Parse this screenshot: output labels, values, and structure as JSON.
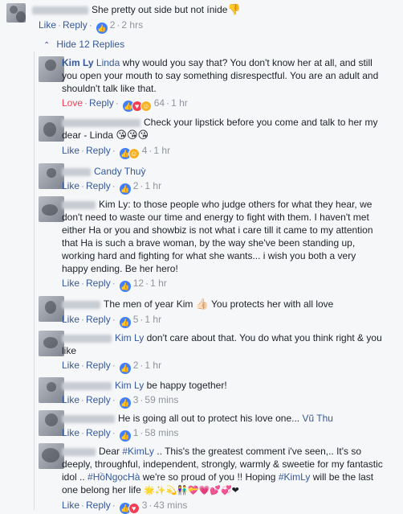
{
  "top_comment": {
    "text": "She pretty out side but not ínide",
    "emoji": "👎",
    "like": "Like",
    "reply": "Reply",
    "reactions": "2",
    "time": "2 hrs"
  },
  "hide_replies": "Hide 12 Replies",
  "replies": [
    {
      "name": "Kim Ly",
      "tag": "Linda",
      "text": "why would you say that? You don't know her at all, and still you open your mouth to say something disrespectful. You are an adult and shouldn't talk like that.",
      "action": "Love",
      "reply": "Reply",
      "reactions": "64",
      "time": "1 hr"
    },
    {
      "text": "Check your lipstick before you come and talk to her my dear - Linda",
      "emoji": "😘😘😘",
      "like": "Like",
      "reply": "Reply",
      "reactions": "4",
      "time": "1 hr"
    },
    {
      "name": "Candy Thuỳ",
      "like": "Like",
      "reply": "Reply",
      "reactions": "2",
      "time": "1 hr"
    },
    {
      "text": "Kim Ly: to those people who judge others for what they hear, we don't need to waste our time and energy to fight with them. I haven't met either Ha or you and showbiz is not what i care till it came to my attention that Ha is such a brave woman, by the way she've been standing up, working hard and fighting for what she wants... i wish you both a very happy ending. Be her hero!",
      "like": "Like",
      "reply": "Reply",
      "reactions": "12",
      "time": "1 hr"
    },
    {
      "text_a": "The men of year Kim",
      "emoji": "👍🏻",
      "text_b": "You protects her with all love",
      "like": "Like",
      "reply": "Reply",
      "reactions": "5",
      "time": "1 hr"
    },
    {
      "tag": "Kim Ly",
      "text": "don't care about that. You do what you think right & you like",
      "like": "Like",
      "reply": "Reply",
      "reactions": "2",
      "time": "1 hr"
    },
    {
      "tag": "Kim Ly",
      "text": "be happy together!",
      "like": "Like",
      "reply": "Reply",
      "reactions": "3",
      "time": "59 mins"
    },
    {
      "text": "He is going all out to protect his love one...",
      "tag": "Vũ Thu",
      "like": "Like",
      "reply": "Reply",
      "reactions": "1",
      "time": "58 mins"
    },
    {
      "text_a": "Dear",
      "tag_a": "#KimLy",
      "text_b": ".. This's the greatest comment i've seen,.. It's so deeply, throughful, independent, strongly, warmly & sweetie for my fantastic idol ..",
      "tag_b": "#HồNgọcHà",
      "text_c": "we're so proud of you !! Hoping",
      "tag_c": "#KimLy",
      "text_d": "will be the last one belong her life",
      "emoji": "🌟✨💫👫💝💗💕💞❤",
      "like": "Like",
      "reply": "Reply",
      "reactions": "3",
      "time": "43 mins"
    }
  ]
}
